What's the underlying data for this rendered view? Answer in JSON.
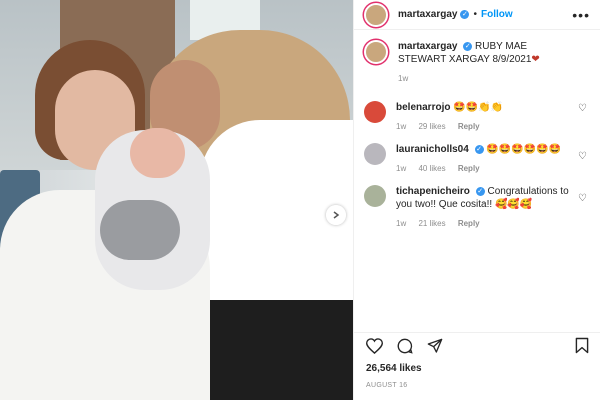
{
  "post": {
    "username": "martaxargay",
    "follow_label": "Follow",
    "more_label": "•••",
    "dot": "•",
    "verified_mark": "✓"
  },
  "caption": {
    "username": "martaxargay",
    "text": "RUBY MAE STEWART XARGAY 8/9/2021",
    "emoji": "❤",
    "time": "1w"
  },
  "comments": [
    {
      "username": "belenarrojo",
      "text": "",
      "emoji": "🤩🤩👏👏",
      "time": "1w",
      "likes": "29 likes",
      "reply": "Reply",
      "verified": false
    },
    {
      "username": "lauranicholls04",
      "text": "",
      "emoji": "🤩🤩🤩🤩🤩🤩",
      "time": "1w",
      "likes": "40 likes",
      "reply": "Reply",
      "verified": true
    },
    {
      "username": "tichapenicheiro",
      "text": "Congratulations to you two!! Que cosita!!",
      "emoji": "🥰🥰🥰",
      "time": "1w",
      "likes": "21 likes",
      "reply": "Reply",
      "verified": true
    }
  ],
  "actions": {
    "like_icon": "heart-icon",
    "comment_icon": "comment-icon",
    "share_icon": "share-icon",
    "save_icon": "bookmark-icon"
  },
  "likes_count": "26,564 likes",
  "date": "AUGUST 16",
  "colors": {
    "accent": "#0095f6",
    "verified": "#3897f0",
    "ring": "#e1306c"
  }
}
